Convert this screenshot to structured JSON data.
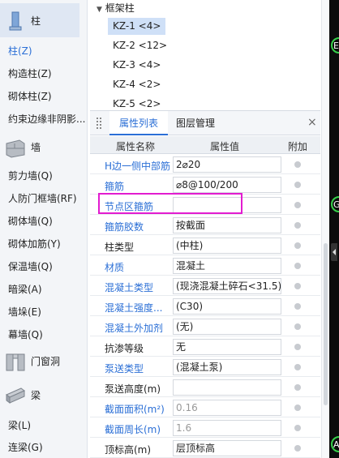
{
  "nav": {
    "categories": [
      {
        "label": "柱",
        "icon": "column-icon"
      },
      {
        "label": "墙",
        "icon": "wall-icon"
      },
      {
        "label": "门窗洞",
        "icon": "door-window-icon"
      },
      {
        "label": "梁",
        "icon": "beam-icon"
      }
    ],
    "column_items": [
      "柱(Z)",
      "构造柱(Z)",
      "砌体柱(Z)",
      "约束边缘非阴影..."
    ],
    "wall_items": [
      "剪力墙(Q)",
      "人防门框墙(RF)",
      "砌体墙(Q)",
      "砌体加筋(Y)",
      "保温墙(Q)",
      "暗梁(A)",
      "墙垛(E)",
      "幕墙(Q)"
    ],
    "beam_items": [
      "梁(L)",
      "连梁(G)"
    ]
  },
  "tree": {
    "root": "框架柱",
    "items": [
      "KZ-1 <4>",
      "KZ-2 <12>",
      "KZ-3 <4>",
      "KZ-4 <2>",
      "KZ-5 <2>"
    ]
  },
  "panel": {
    "tab_active": "属性列表",
    "tab_other": "图层管理",
    "close": "×",
    "col_name": "属性名称",
    "col_value": "属性值",
    "col_extra": "附加",
    "rows": [
      {
        "name": "H边一侧中部筋",
        "value": "2⌀20"
      },
      {
        "name": "箍筋",
        "value": "⌀8@100/200"
      },
      {
        "name": "节点区箍筋",
        "value": ""
      },
      {
        "name": "箍筋胶数",
        "value": "按截面"
      },
      {
        "name": "柱类型",
        "value": "(中柱)"
      },
      {
        "name": "材质",
        "value": "混凝土"
      },
      {
        "name": "混凝土类型",
        "value": "(现浇混凝土碎石<31.5)"
      },
      {
        "name": "混凝土强度...",
        "value": "(C30)"
      },
      {
        "name": "混凝土外加剂",
        "value": "(无)"
      },
      {
        "name": "抗渗等级",
        "value": "无"
      },
      {
        "name": "泵送类型",
        "value": "(混凝土泵)"
      },
      {
        "name": "泵送高度(m)",
        "value": ""
      },
      {
        "name": "截面面积(m²)",
        "value": "0.16"
      },
      {
        "name": "截面周长(m)",
        "value": "1.6"
      },
      {
        "name": "顶标高(m)",
        "value": "层顶标高"
      }
    ]
  },
  "canvas": {
    "labels": [
      "E",
      "G",
      "A"
    ]
  },
  "colors": {
    "accent": "#2b6fd6",
    "highlight": "#e21cd0",
    "canvas": "#0c0c0c",
    "axis_bubble": "#37d04a"
  }
}
